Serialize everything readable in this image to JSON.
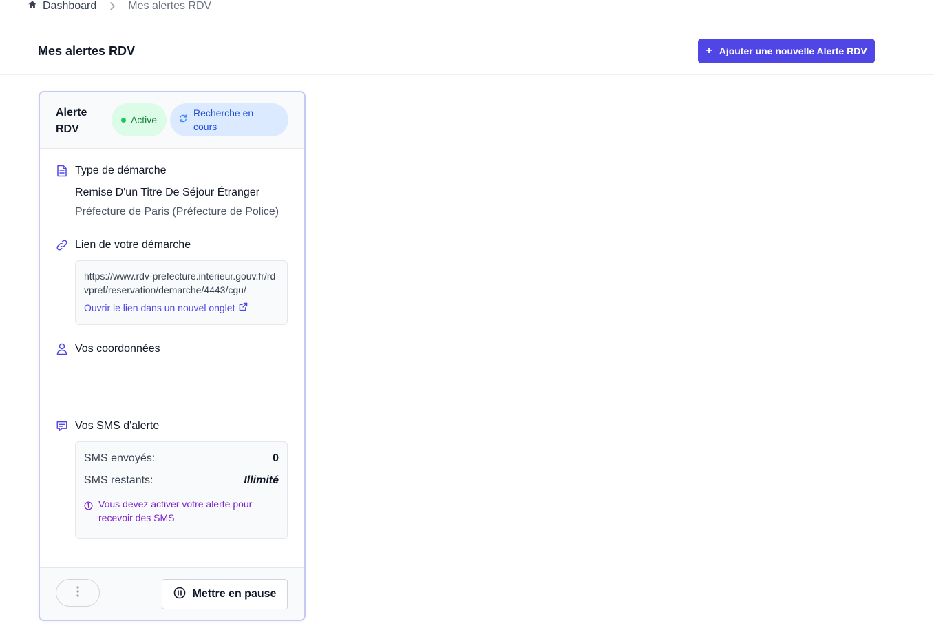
{
  "breadcrumb": {
    "home": "Dashboard",
    "current": "Mes alertes RDV"
  },
  "header": {
    "title": "Mes alertes RDV",
    "add_button": "Ajouter une nouvelle Alerte RDV"
  },
  "card": {
    "title": "Alerte RDV",
    "badge_status": "Active",
    "badge_search": "Recherche en cours",
    "procedure": {
      "title": "Type de démarche",
      "name": "Remise D'un Titre De Séjour Étranger",
      "place": "Préfecture de Paris (Préfecture de Police)"
    },
    "link": {
      "title": "Lien de votre démarche",
      "url": "https://www.rdv-prefecture.interieur.gouv.fr/rdvpref/reservation/demarche/4443/cgu/",
      "open_label": "Ouvrir le lien dans un nouvel onglet"
    },
    "contact": {
      "title": "Vos coordonnées"
    },
    "sms": {
      "title": "Vos SMS d'alerte",
      "sent_label": "SMS envoyés:",
      "sent_value": "0",
      "remaining_label": "SMS restants:",
      "remaining_value": "Illimité",
      "note": "Vous devez activer votre alerte pour recevoir des SMS"
    },
    "footer": {
      "pause_button": "Mettre en pause"
    }
  },
  "colors": {
    "accent": "#4f46e5",
    "active_bg": "#dcfce7",
    "active_text": "#15803d",
    "search_bg": "#dbeafe",
    "search_text": "#1d4ed8",
    "note_text": "#7e22ce"
  },
  "icons": {
    "home": "home-icon",
    "chevron": "chevron-right-icon",
    "document": "document-icon",
    "link": "link-icon",
    "user": "user-icon",
    "chat": "chat-icon",
    "refresh": "refresh-icon",
    "external": "external-link-icon",
    "info": "info-icon",
    "more": "dots-vertical-icon",
    "pause": "pause-icon"
  }
}
